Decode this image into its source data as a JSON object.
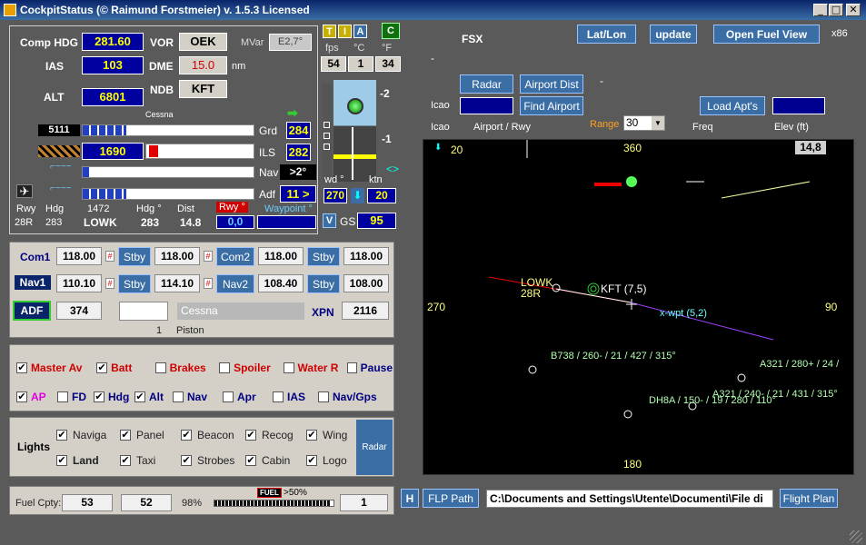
{
  "title": "CockpitStatus (© Raimund Forstmeier) v. 1.5.3 Licensed",
  "window_buttons": {
    "min": "_",
    "max": "□",
    "close": "✕"
  },
  "instr": {
    "hdg_label": "Comp HDG",
    "hdg": "281.60",
    "ias_label": "IAS",
    "ias": "103",
    "alt_label": "ALT",
    "alt": "6801",
    "vor_label": "VOR",
    "vor": "OEK",
    "dme_label": "DME",
    "dme": "15.0",
    "dme_unit": "nm",
    "ndb_label": "NDB",
    "ndb": "KFT",
    "mvar_label": "MVar",
    "mvar": "E2,7°",
    "aircraft": "Cessna",
    "bar1_val": "5111",
    "grd_label": "Grd",
    "grd": "284",
    "bar2_val": "1690",
    "ils_label": "ILS",
    "ils": "282",
    "nav_label": "Nav",
    "nav": ">2°",
    "adf_label": "Adf",
    "adf": "11 >",
    "rwy_h": "Rwy",
    "rwy": "28R",
    "hdg_h": "Hdg",
    "hdg2": "283",
    "num_h": "1472",
    "apt": "LOWK",
    "hdgdeg_h": "Hdg °",
    "hdgdeg": "283",
    "dist_h": "Dist",
    "dist": "14.8",
    "rwydeg_h": "Rwy °",
    "rwydeg": "0,0",
    "wpt_h": "Waypoint °"
  },
  "topmid": {
    "t": "T",
    "i": "I",
    "a": "A",
    "c": "C",
    "fps_h": "fps",
    "c_h": "°C",
    "f_h": "°F",
    "fps": "54",
    "celsius": "1",
    "fahrenheit": "34",
    "scale_hi": "-2",
    "scale_lo": "-1",
    "wd_h": "wd °",
    "ktn_h": "ktn",
    "wd": "270",
    "ktn": "20",
    "v": "V",
    "gs_h": "GS",
    "gs": "95"
  },
  "radios": {
    "com1": "Com1",
    "com1_act": "118.00",
    "stby": "Stby",
    "com1_sb": "118.00",
    "com2": "Com2",
    "com2_act": "118.00",
    "com2_sb": "118.00",
    "nav1": "Nav1",
    "nav1_act": "110.10",
    "nav1_sb": "114.10",
    "nav2": "Nav2",
    "nav2_act": "108.40",
    "nav2_sb": "108.00",
    "adf": "ADF",
    "adf_val": "374",
    "aircraft": "Cessna",
    "xpn_label": "XPN",
    "xpn": "2116",
    "engines": "1",
    "engine_type": "Piston"
  },
  "switches": {
    "row1": [
      {
        "label": "Master Av",
        "checked": true,
        "color": "red"
      },
      {
        "label": "Batt",
        "checked": true,
        "color": "red"
      },
      {
        "label": "Brakes",
        "checked": false,
        "color": "red"
      },
      {
        "label": "Spoiler",
        "checked": false,
        "color": "red"
      },
      {
        "label": "Water R",
        "checked": false,
        "color": "red"
      },
      {
        "label": "Pause",
        "checked": false,
        "color": "blue"
      }
    ],
    "row2": [
      {
        "label": "AP",
        "checked": true,
        "color": "magenta"
      },
      {
        "label": "FD",
        "checked": false,
        "color": "blue"
      },
      {
        "label": "Hdg",
        "checked": true,
        "color": "blue"
      },
      {
        "label": "Alt",
        "checked": true,
        "color": "blue"
      },
      {
        "label": "Nav",
        "checked": false,
        "color": "blue"
      },
      {
        "label": "Apr",
        "checked": false,
        "color": "blue"
      },
      {
        "label": "IAS",
        "checked": false,
        "color": "blue"
      },
      {
        "label": "Nav/Gps",
        "checked": false,
        "color": "blue"
      }
    ]
  },
  "lights": {
    "title": "Lights",
    "items": [
      {
        "label": "Naviga",
        "checked": true
      },
      {
        "label": "Panel",
        "checked": true
      },
      {
        "label": "Beacon",
        "checked": true
      },
      {
        "label": "Recog",
        "checked": true
      },
      {
        "label": "Wing",
        "checked": true
      },
      {
        "label": "Land",
        "checked": true
      },
      {
        "label": "Taxi",
        "checked": true
      },
      {
        "label": "Strobes",
        "checked": true
      },
      {
        "label": "Cabin",
        "checked": true
      },
      {
        "label": "Logo",
        "checked": true
      }
    ],
    "radar_btn": "Radar"
  },
  "fuel": {
    "label": "Fuel Cpty:",
    "left": "53",
    "right": "52",
    "pct": "98%",
    "badge": "FUEL",
    "warn": ">50%",
    "count": "1",
    "level": 0.98
  },
  "right": {
    "sim": "FSX",
    "dash1": "-",
    "dash2": "-",
    "latlon": "Lat/Lon",
    "update": "update",
    "open_fuel": "Open Fuel View",
    "x86": "x86",
    "radar_btn": "Radar",
    "airport_dist": "Airport Dist",
    "find_airport": "Find Airport",
    "load_apts": "Load Apt's",
    "icao1": "Icao",
    "icao2": "Icao",
    "airport_rwy": "Airport / Rwy",
    "range_label": "Range",
    "range": "30",
    "freq": "Freq",
    "elev": "Elev (ft)",
    "scroll_left": "<>",
    "scroll_right": "<",
    "h": "H",
    "flp": "FLP Path",
    "path": "C:\\Documents and Settings\\Utente\\Documenti\\File di",
    "flight_plan": "Flight Plan"
  },
  "radar": {
    "hdg_n": "360",
    "hdg_e": "90",
    "hdg_s": "180",
    "hdg_w": "270",
    "wind": "20",
    "dist": "14,8",
    "apt": "LOWK",
    "apt_rwy": "28R",
    "ndb": "KFT (7,5)",
    "wpt": "x-wpt (5,2)",
    "traffic": [
      {
        "label": "B738 / 260- / 21 / 427 / 315°"
      },
      {
        "label": "A321 / 280+ / 24 /"
      },
      {
        "label": "A321 / 240- / 21 / 431 / 315°"
      },
      {
        "label": "DH8A / 150- / 19 / 280 / 110°"
      }
    ]
  }
}
